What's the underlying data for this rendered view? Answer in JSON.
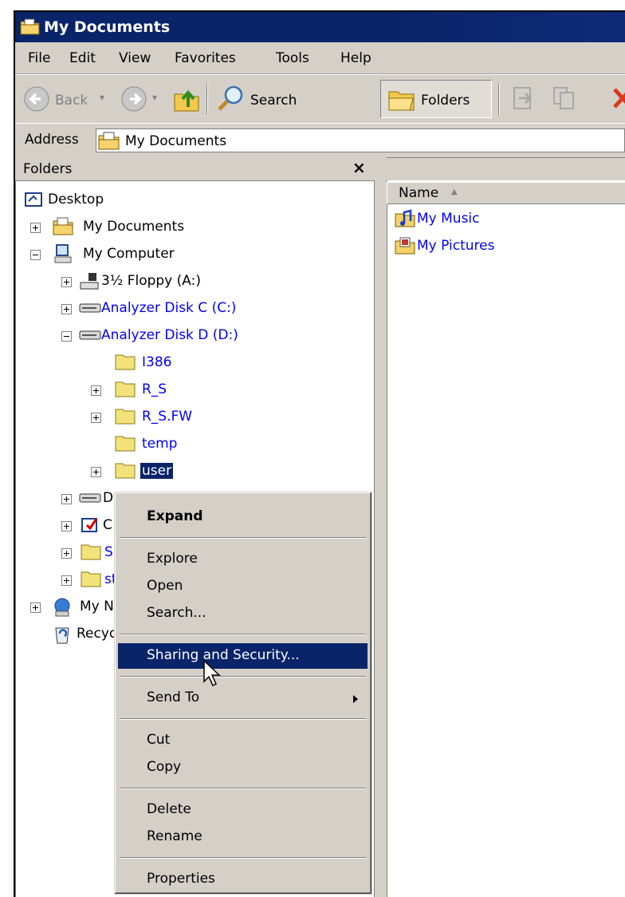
{
  "window": {
    "title": "My Documents"
  },
  "menubar": [
    "File",
    "Edit",
    "View",
    "Favorites",
    "Tools",
    "Help"
  ],
  "toolbar": {
    "back_label": "Back",
    "search_label": "Search",
    "folders_label": "Folders"
  },
  "address": {
    "label": "Address",
    "value": "My Documents"
  },
  "folders_pane": {
    "title": "Folders",
    "close_glyph": "×"
  },
  "tree": [
    {
      "label": "Desktop",
      "icon": "desktop-icon"
    },
    {
      "label": "My Documents",
      "icon": "folder-documents-icon",
      "toggle": "+"
    },
    {
      "label": "My Computer",
      "icon": "computer-icon",
      "toggle": "-"
    },
    {
      "label": "3½ Floppy (A:)",
      "icon": "floppy-icon",
      "toggle": "+"
    },
    {
      "label": "Analyzer Disk C (C:)",
      "icon": "drive-icon",
      "toggle": "+"
    },
    {
      "label": "Analyzer Disk D (D:)",
      "icon": "drive-icon",
      "toggle": "-"
    },
    {
      "label": "I386",
      "icon": "folder-icon"
    },
    {
      "label": "R_S",
      "icon": "folder-icon",
      "toggle": "+"
    },
    {
      "label": "R_S.FW",
      "icon": "folder-icon",
      "toggle": "+"
    },
    {
      "label": "temp",
      "icon": "folder-icon"
    },
    {
      "label": "user",
      "icon": "folder-icon",
      "toggle": "+",
      "selected": true
    },
    {
      "label": "D",
      "icon": "drive-icon",
      "toggle": "+"
    },
    {
      "label": "C",
      "icon": "control-panel-icon",
      "toggle": "+"
    },
    {
      "label": "Sl",
      "icon": "folder-icon",
      "toggle": "+"
    },
    {
      "label": "st",
      "icon": "folder-icon",
      "toggle": "+"
    },
    {
      "label": "My Ne",
      "icon": "network-icon",
      "toggle": "+"
    },
    {
      "label": "Recyc",
      "icon": "recycle-bin-icon"
    }
  ],
  "files": {
    "column_name": "Name",
    "items": [
      {
        "label": "My Music",
        "icon": "music-folder-icon"
      },
      {
        "label": "My Pictures",
        "icon": "pictures-folder-icon"
      }
    ]
  },
  "context_menu": {
    "expand": "Expand",
    "explore": "Explore",
    "open": "Open",
    "search": "Search...",
    "sharing": "Sharing and Security...",
    "send_to": "Send To",
    "cut": "Cut",
    "copy": "Copy",
    "delete": "Delete",
    "rename": "Rename",
    "properties": "Properties"
  }
}
